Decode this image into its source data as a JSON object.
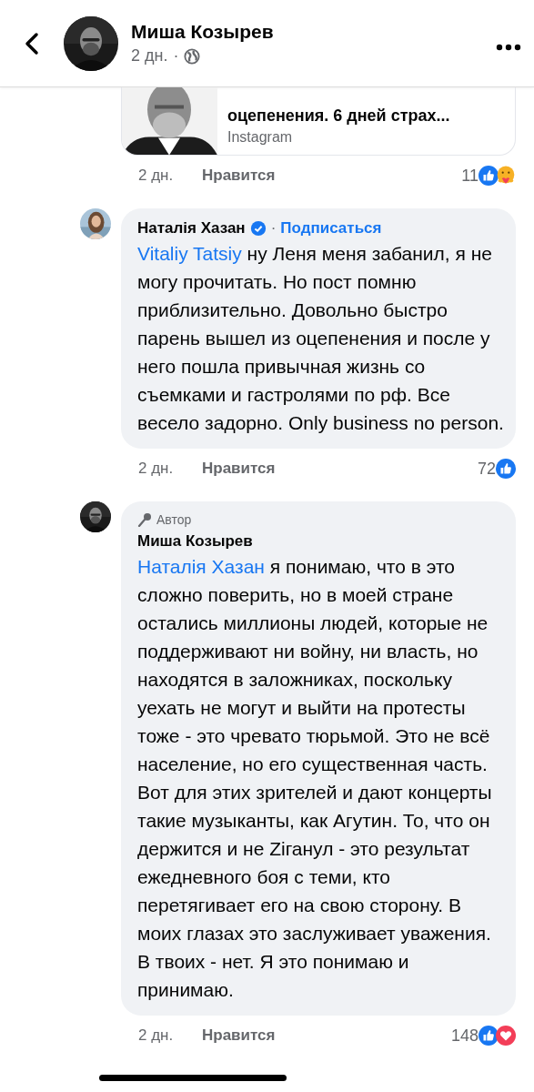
{
  "header": {
    "author": "Миша Козырев",
    "time": "2 дн.",
    "separator": "·"
  },
  "link_card": {
    "title": "оцепенения. 6 дней страх...",
    "source": "Instagram"
  },
  "top_meta": {
    "time": "2 дн.",
    "like": "Нравится",
    "count": "11",
    "reactions": [
      {
        "kind": "like"
      },
      {
        "kind": "care"
      }
    ]
  },
  "comments": [
    {
      "author": "Наталія Хазан",
      "verified": true,
      "follow": "Подписаться",
      "dot": "·",
      "mention": "Vitaliy Tatsiy",
      "text": " ну Леня меня забанил, я не могу прочитать. Но пост помню приблизительно. Довольно быстро парень вышел из оцепенения и после у него пошла привычная жизнь со съемками и гастролями по рф. Все весело задорно. Only business no person.",
      "time": "2 дн.",
      "like": "Нравится",
      "count": "72",
      "reactions": [
        {
          "kind": "like"
        }
      ]
    },
    {
      "author": "Миша Козырев",
      "verified": false,
      "author_badge": "Автор",
      "mention": "Наталія Хазан",
      "text": " я понимаю, что в это сложно поверить, но в моей стране остались миллионы людей, которые не поддерживают ни войну, ни власть, но находятся в заложниках, поскольку уехать не могут и выйти на протесты тоже - это чревато тюрьмой. Это не всё население, но его существенная часть. Вот для этих зрителей и дают концерты такие музыканты, как Агутин. То, что он держится и не Ziганул - это результат ежедневного боя с теми, кто перетягивает его на свою сторону.  В моих глазах это заслуживает уважения. В твоих - нет. Я это понимаю и принимаю.",
      "time": "2 дн.",
      "like": "Нравится",
      "count": "148",
      "reactions": [
        {
          "kind": "like"
        },
        {
          "kind": "love"
        }
      ]
    }
  ]
}
